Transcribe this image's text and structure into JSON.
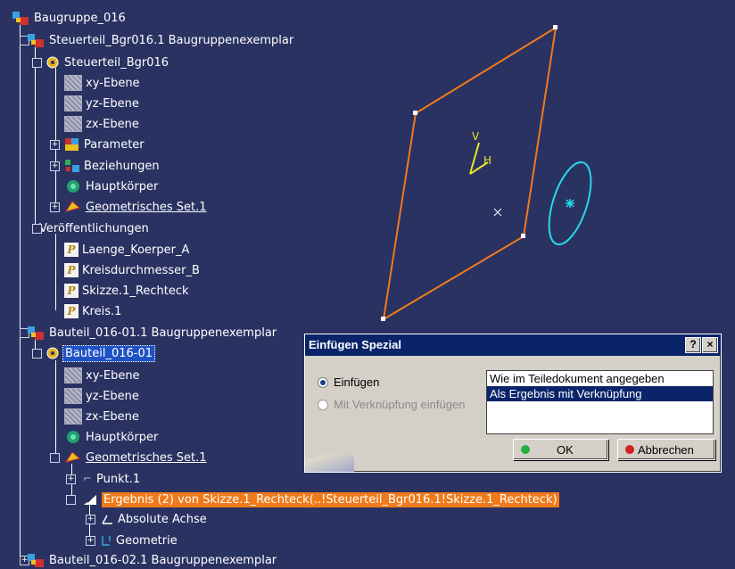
{
  "tree": {
    "root": "Baugruppe_016",
    "items": [
      {
        "label": "Steuerteil_Bgr016.1 Baugruppenexemplar"
      },
      {
        "label": "Steuerteil_Bgr016"
      },
      {
        "label": "xy-Ebene"
      },
      {
        "label": "yz-Ebene"
      },
      {
        "label": "zx-Ebene"
      },
      {
        "label": "Parameter"
      },
      {
        "label": "Beziehungen"
      },
      {
        "label": "Hauptkörper"
      },
      {
        "label": "Geometrisches Set.1"
      },
      {
        "label": "Veröffentlichungen"
      },
      {
        "label": "Laenge_Koerper_A"
      },
      {
        "label": "Kreisdurchmesser_B"
      },
      {
        "label": "Skizze.1_Rechteck"
      },
      {
        "label": "Kreis.1"
      },
      {
        "label": "Bauteil_016-01.1 Baugruppenexemplar"
      },
      {
        "label": "Bauteil_016-01"
      },
      {
        "label": "xy-Ebene"
      },
      {
        "label": "yz-Ebene"
      },
      {
        "label": "zx-Ebene"
      },
      {
        "label": "Hauptkörper"
      },
      {
        "label": "Geometrisches Set.1"
      },
      {
        "label": "Punkt.1"
      },
      {
        "label": "Ergebnis (2) von Skizze.1_Rechteck(..!Steuerteil_Bgr016.1!Skizze.1_Rechteck)"
      },
      {
        "label": "Absolute Achse"
      },
      {
        "label": "Geometrie"
      },
      {
        "label": "Bauteil_016-02.1 Baugruppenexemplar"
      }
    ]
  },
  "viewport": {
    "axis_v": "V",
    "axis_h": "H",
    "colors": {
      "rectangle": "#f07a1a",
      "circle": "#26d6e8",
      "axes": "#e6e62a",
      "background": "#2a3262"
    }
  },
  "dialog": {
    "title": "Einfügen Spezial",
    "help_btn": "?",
    "close_btn": "×",
    "radio_insert": "Einfügen",
    "radio_link": "Mit Verknüpfung einfügen",
    "options": [
      "Wie im Teiledokument angegeben",
      "Als Ergebnis mit Verknüpfung"
    ],
    "ok": "OK",
    "cancel": "Abbrechen"
  }
}
